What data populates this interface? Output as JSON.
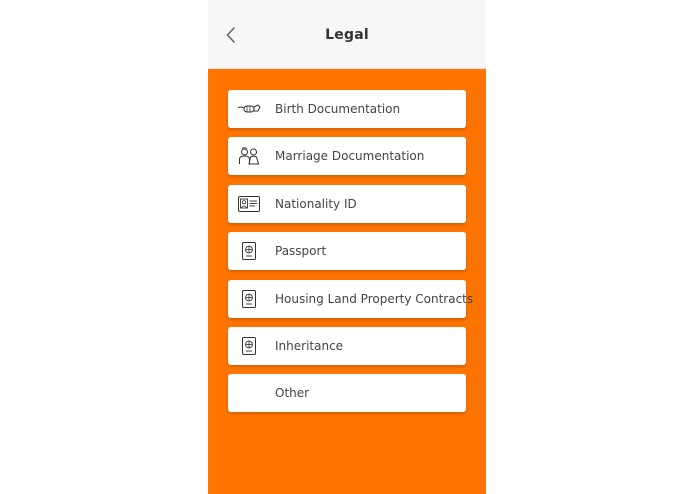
{
  "header": {
    "title": "Legal",
    "back_icon": "chevron-left-icon"
  },
  "colors": {
    "accent": "#ff7400",
    "header_bg": "#f7f7f7",
    "card_bg": "#ffffff",
    "text": "#444444"
  },
  "items": [
    {
      "label": "Birth Documentation",
      "icon": "baby-bottle-icon"
    },
    {
      "label": "Marriage Documentation",
      "icon": "couple-icon"
    },
    {
      "label": "Nationality ID",
      "icon": "id-card-icon"
    },
    {
      "label": "Passport",
      "icon": "passport-icon"
    },
    {
      "label": "Housing Land Property Contracts",
      "icon": "passport-icon"
    },
    {
      "label": "Inheritance",
      "icon": "passport-icon"
    },
    {
      "label": "Other",
      "icon": ""
    }
  ]
}
